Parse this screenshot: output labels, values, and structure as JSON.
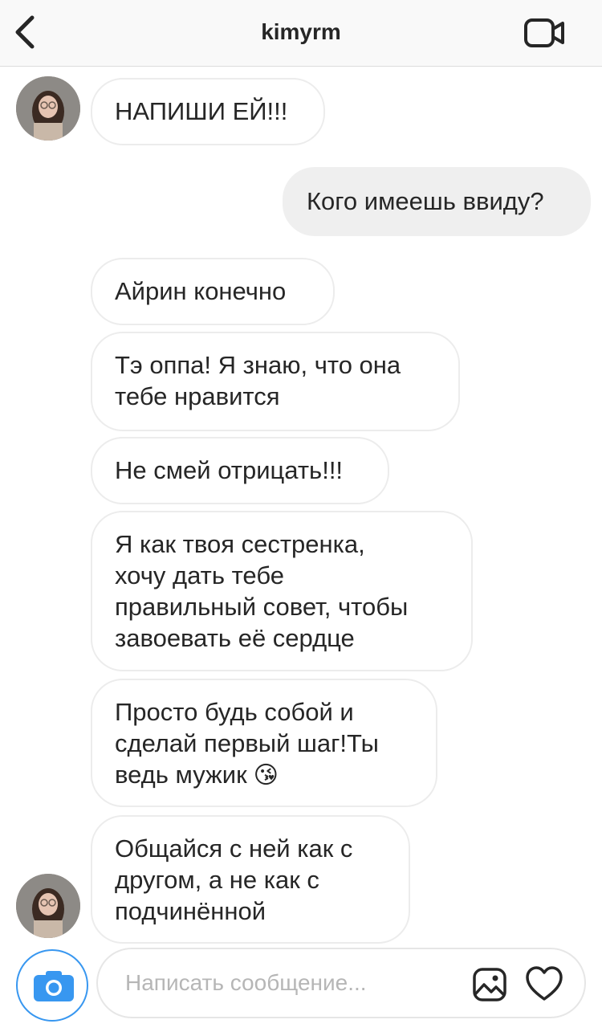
{
  "header": {
    "username": "kimyrm",
    "back_icon": "chevron-left-icon",
    "video_icon": "video-camera-icon"
  },
  "messages": [
    {
      "direction": "in",
      "text": "НАПИШИ ЕЙ!!!"
    },
    {
      "direction": "out",
      "text": "Кого имеешь ввиду?"
    },
    {
      "direction": "in",
      "text": "Айрин конечно"
    },
    {
      "direction": "in",
      "text": "Тэ оппа! Я знаю, что она\nтебе нравится"
    },
    {
      "direction": "in",
      "text": "Не смей отрицать!!!"
    },
    {
      "direction": "in",
      "text": "Я как твоя сестренка,\nхочу дать тебе\nправильный совет, чтобы\nзавоевать её сердце"
    },
    {
      "direction": "in",
      "text": "Просто будь собой и\nсделай первый шаг!Ты\nведь мужик",
      "emoji": "😘"
    },
    {
      "direction": "in",
      "text": "Общайся с ней как с\nдругом, а не как с\nподчинённой"
    }
  ],
  "composer": {
    "placeholder": "Написать сообщение...",
    "camera_icon": "camera-icon",
    "gallery_icon": "image-gallery-icon",
    "heart_icon": "heart-icon",
    "accent": "#3897f0"
  }
}
